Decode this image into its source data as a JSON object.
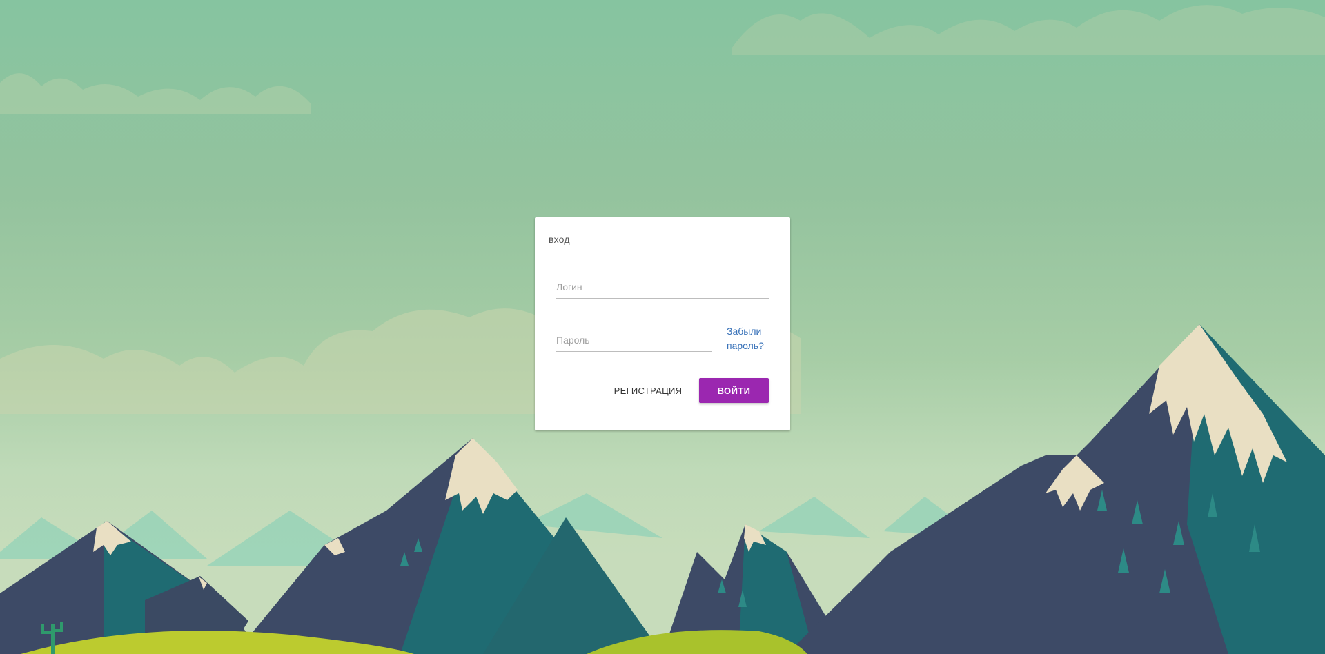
{
  "login_card": {
    "title": "вход",
    "login_placeholder": "Логин",
    "password_placeholder": "Пароль",
    "forgot_password_line1": "Забыли",
    "forgot_password_line2": "пароль?",
    "register_label": "РЕГИСТРАЦИЯ",
    "submit_label": "ВОЙТИ"
  },
  "colors": {
    "accent": "#9b27b0",
    "link": "#3a73b9",
    "sky": "#94c39e",
    "mountain_dark": "#3b4a63",
    "mountain_teal": "#1f6b72",
    "meadow": "#bccb2f"
  },
  "background": {
    "icon": "mountain-landscape-illustration"
  }
}
